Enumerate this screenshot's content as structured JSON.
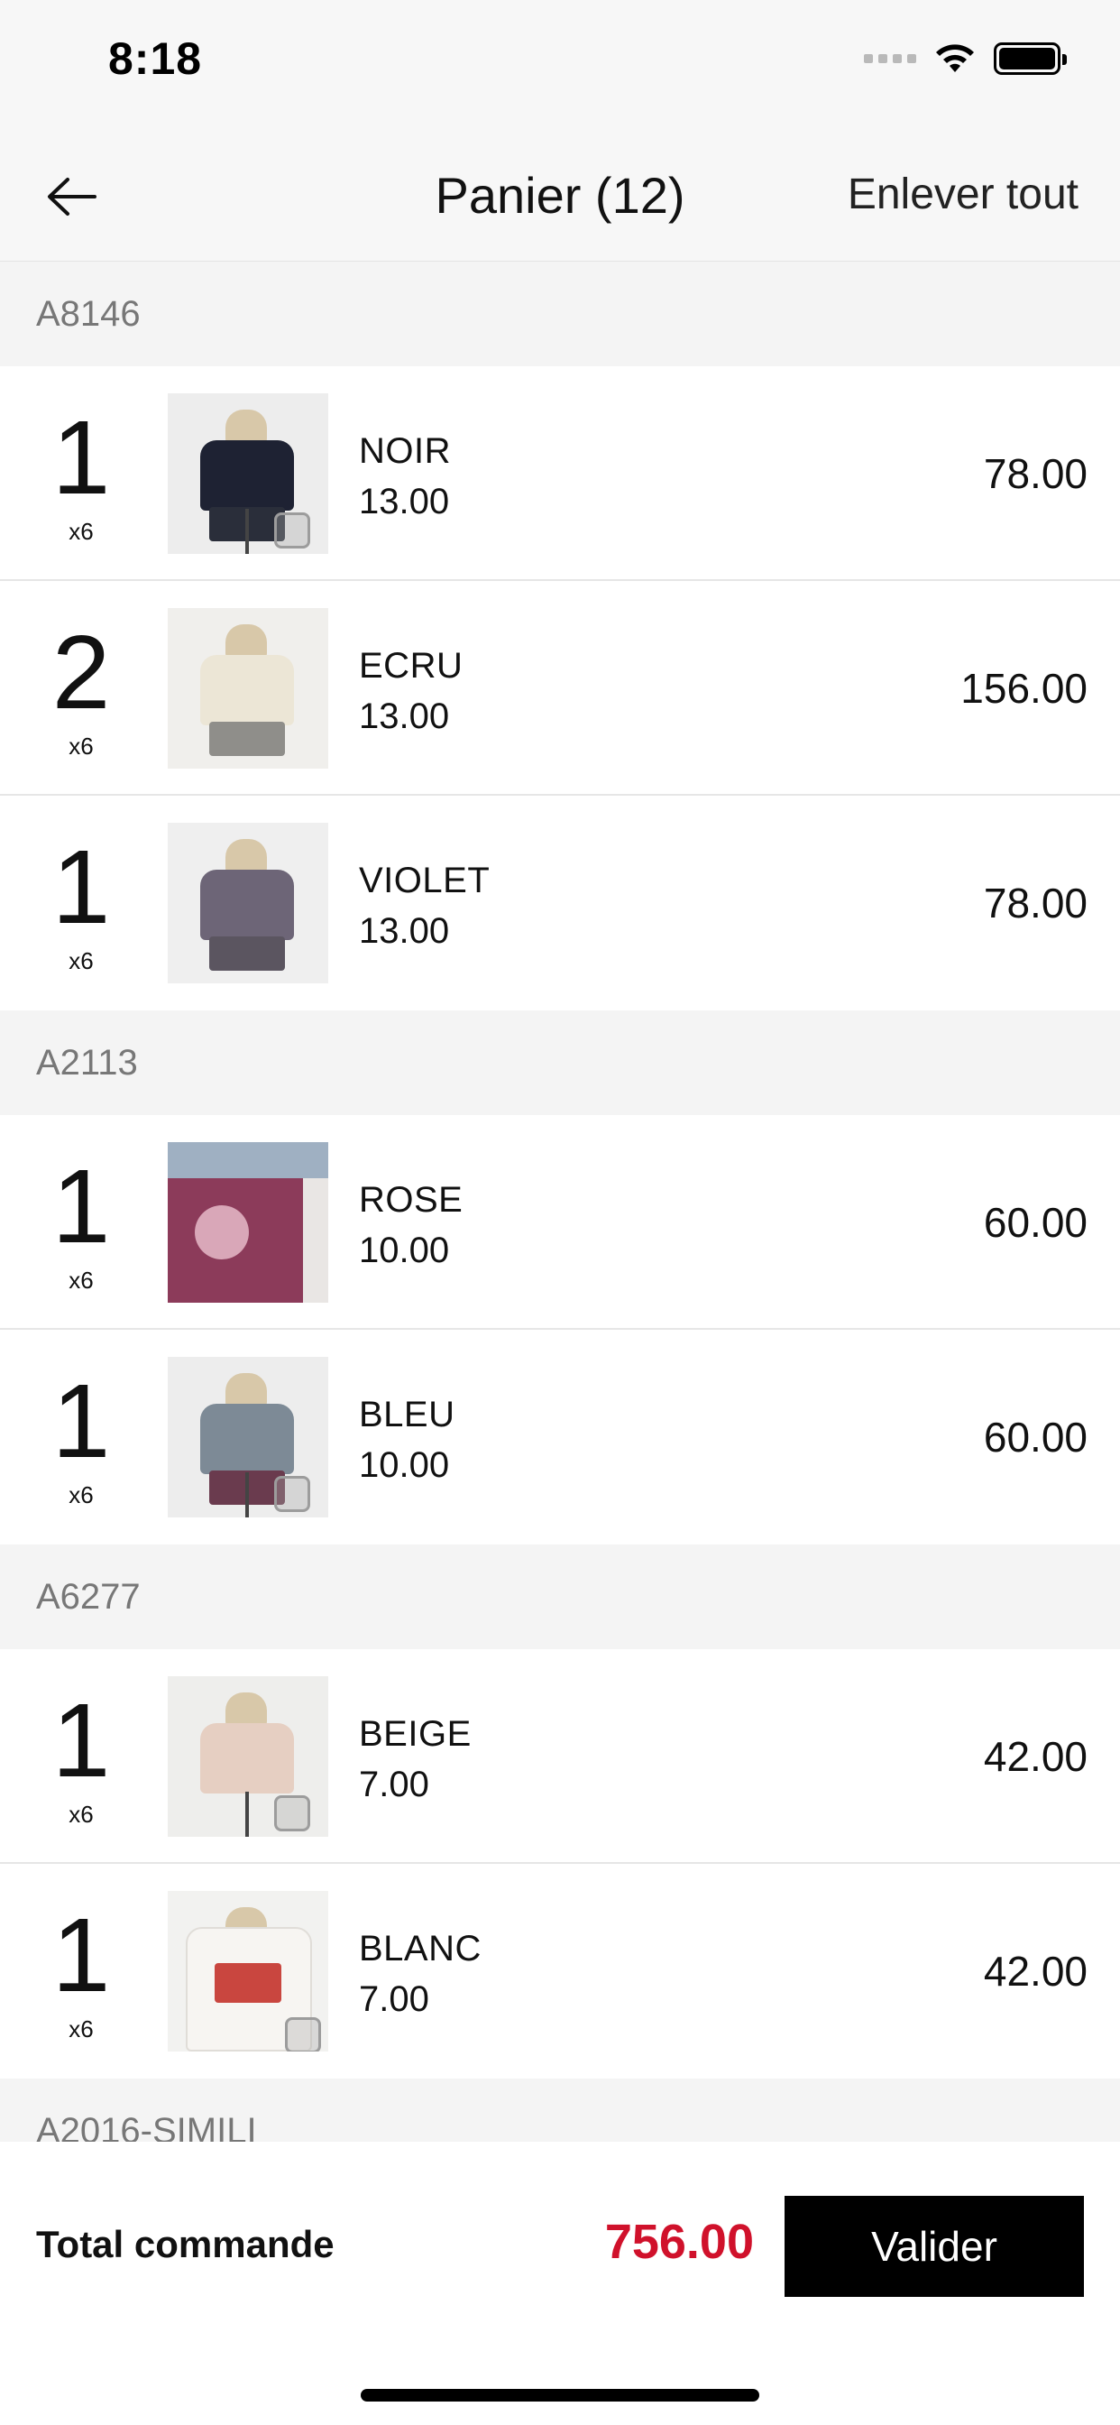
{
  "status": {
    "time": "8:18",
    "icons": [
      "signal-icon",
      "wifi-icon",
      "battery-icon"
    ]
  },
  "nav": {
    "title": "Panier (12)",
    "action": "Enlever tout",
    "back_icon": "arrow-left-icon"
  },
  "sections": [
    {
      "code": "A8146",
      "items": [
        {
          "qty": "1",
          "unit": "x6",
          "color": "NOIR",
          "price": "13.00",
          "total": "78.00"
        },
        {
          "qty": "2",
          "unit": "x6",
          "color": "ECRU",
          "price": "13.00",
          "total": "156.00"
        },
        {
          "qty": "1",
          "unit": "x6",
          "color": "VIOLET",
          "price": "13.00",
          "total": "78.00"
        }
      ]
    },
    {
      "code": "A2113",
      "items": [
        {
          "qty": "1",
          "unit": "x6",
          "color": "ROSE",
          "price": "10.00",
          "total": "60.00"
        },
        {
          "qty": "1",
          "unit": "x6",
          "color": "BLEU",
          "price": "10.00",
          "total": "60.00"
        }
      ]
    },
    {
      "code": "A6277",
      "items": [
        {
          "qty": "1",
          "unit": "x6",
          "color": "BEIGE",
          "price": "7.00",
          "total": "42.00"
        },
        {
          "qty": "1",
          "unit": "x6",
          "color": "BLANC",
          "price": "7.00",
          "total": "42.00"
        }
      ]
    },
    {
      "code": "A2016-SIMILI",
      "items": []
    }
  ],
  "footer": {
    "total_label": "Total commande",
    "total_value": "756.00",
    "validate_label": "Valider"
  },
  "colors": {
    "accent_total": "#d0112b",
    "button_bg": "#000000"
  }
}
